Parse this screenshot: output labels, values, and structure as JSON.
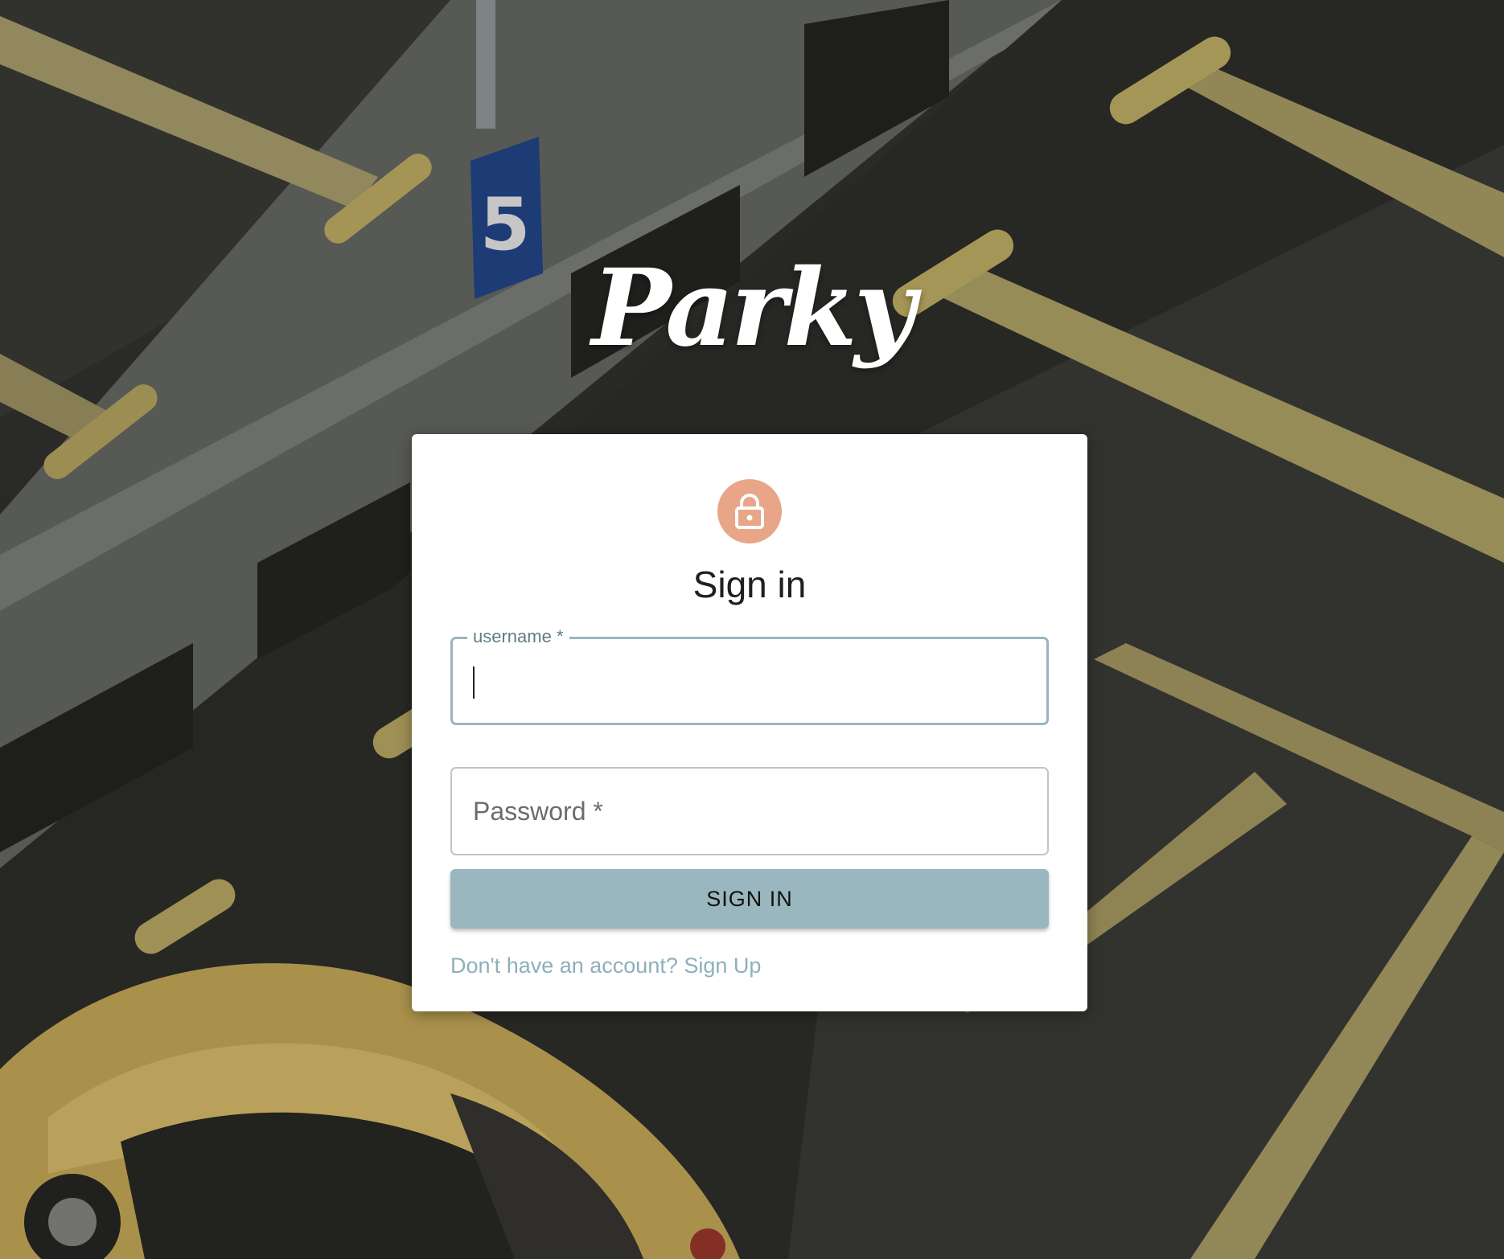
{
  "brand": {
    "logo_text": "Parky"
  },
  "background": {
    "stall_number": "5"
  },
  "signin": {
    "title": "Sign in",
    "icon": "lock-icon",
    "username_label": "username *",
    "username_value": "",
    "password_placeholder": "Password *",
    "password_value": "",
    "submit_label": "SIGN IN",
    "signup_link": "Don't have an account? Sign Up"
  },
  "colors": {
    "avatar": "#e8a588",
    "accent": "#9ab7bf",
    "focused_border": "#98b5bf",
    "link": "#8db0ba"
  }
}
